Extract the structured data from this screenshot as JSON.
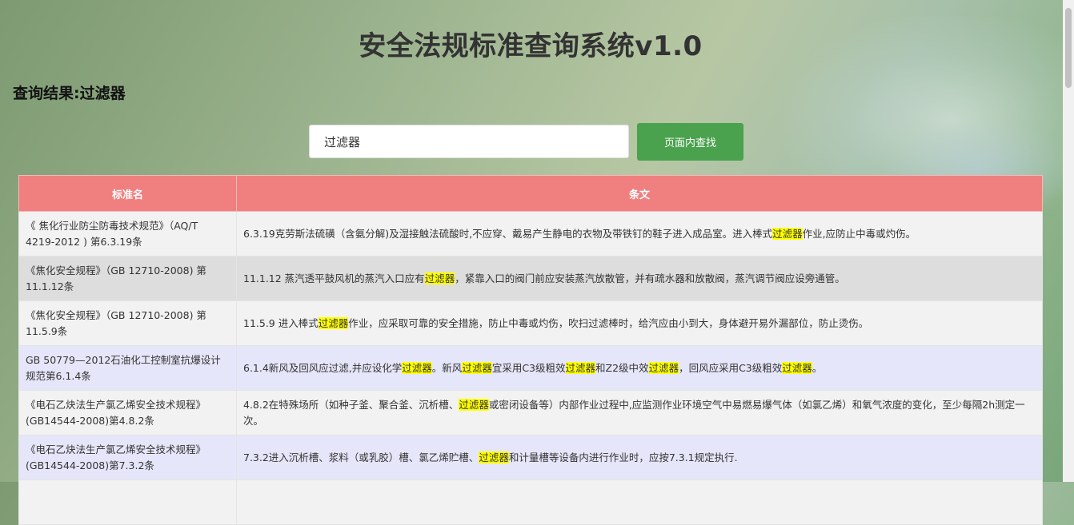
{
  "page": {
    "title": "安全法规标准查询系统v1.0",
    "result_label": "查询结果:过滤器"
  },
  "search": {
    "value": "过滤器",
    "button_label": "页面内查找",
    "highlight": "过滤器"
  },
  "table": {
    "columns": [
      "标准名",
      "条文"
    ],
    "rows": [
      {
        "standard": "《 焦化行业防尘防毒技术规范》（AQ/T 4219-2012 ) 第6.3.19条",
        "clause": "6.3.19克劳斯法硫磺（含氨分解)及湿接触法硫酸时,不应穿、戴易产生静电的衣物及带铁钉的鞋子进入成品室。进入棒式过滤器作业,应防止中毒或灼伤。",
        "bg": "#f2f2f2"
      },
      {
        "standard": "《焦化安全规程》（GB 12710-2008) 第11.1.12条",
        "clause": "11.1.12 蒸汽透平鼓风机的蒸汽入口应有过滤器，紧靠入口的阀门前应安装蒸汽放散管，并有疏水器和放散阀，蒸汽调节阀应设旁通管。",
        "bg": "#dddddd"
      },
      {
        "standard": "《焦化安全规程》（GB 12710-2008) 第11.5.9条",
        "clause": "11.5.9 进入棒式过滤器作业，应采取可靠的安全措施，防止中毒或灼伤，吹扫过滤棒时，给汽应由小到大，身体避开易外漏部位，防止烫伤。",
        "bg": "#f2f2f2"
      },
      {
        "standard": "GB 50779—2012石油化工控制室抗爆设计规范第6.1.4条",
        "clause": "6.1.4新风及回风应过滤,并应设化学过滤器。新风过滤器宜采用C3级粗效过滤器和Z2级中效过滤器，回风应采用C3级粗效过滤器。",
        "bg": "#e6e6fa"
      },
      {
        "standard": "《电石乙炔法生产氯乙烯安全技术规程》(GB14544-2008)第4.8.2条",
        "clause": "4.8.2在特殊场所（如种子釜、聚合釜、沉析槽、过滤器或密闭设备等）内部作业过程中,应监测作业环境空气中易燃易爆气体（如氯乙烯）和氧气浓度的变化，至少每隔2h测定一次。",
        "bg": "#f2f2f2"
      },
      {
        "standard": "《电石乙炔法生产氯乙烯安全技术规程》(GB14544-2008)第7.3.2条",
        "clause": "7.3.2进入沉析槽、浆料（或乳胶）槽、氯乙烯贮槽、过滤器和计量槽等设备内进行作业时，应按7.3.1规定执行.",
        "bg": "#e6e6fa"
      },
      {
        "standard": "",
        "clause": "",
        "bg": "#f2f2f2"
      }
    ]
  },
  "colors": {
    "header_bg": "#f07f7f",
    "button_bg": "#4aa14e",
    "highlight": "#ffff00"
  }
}
